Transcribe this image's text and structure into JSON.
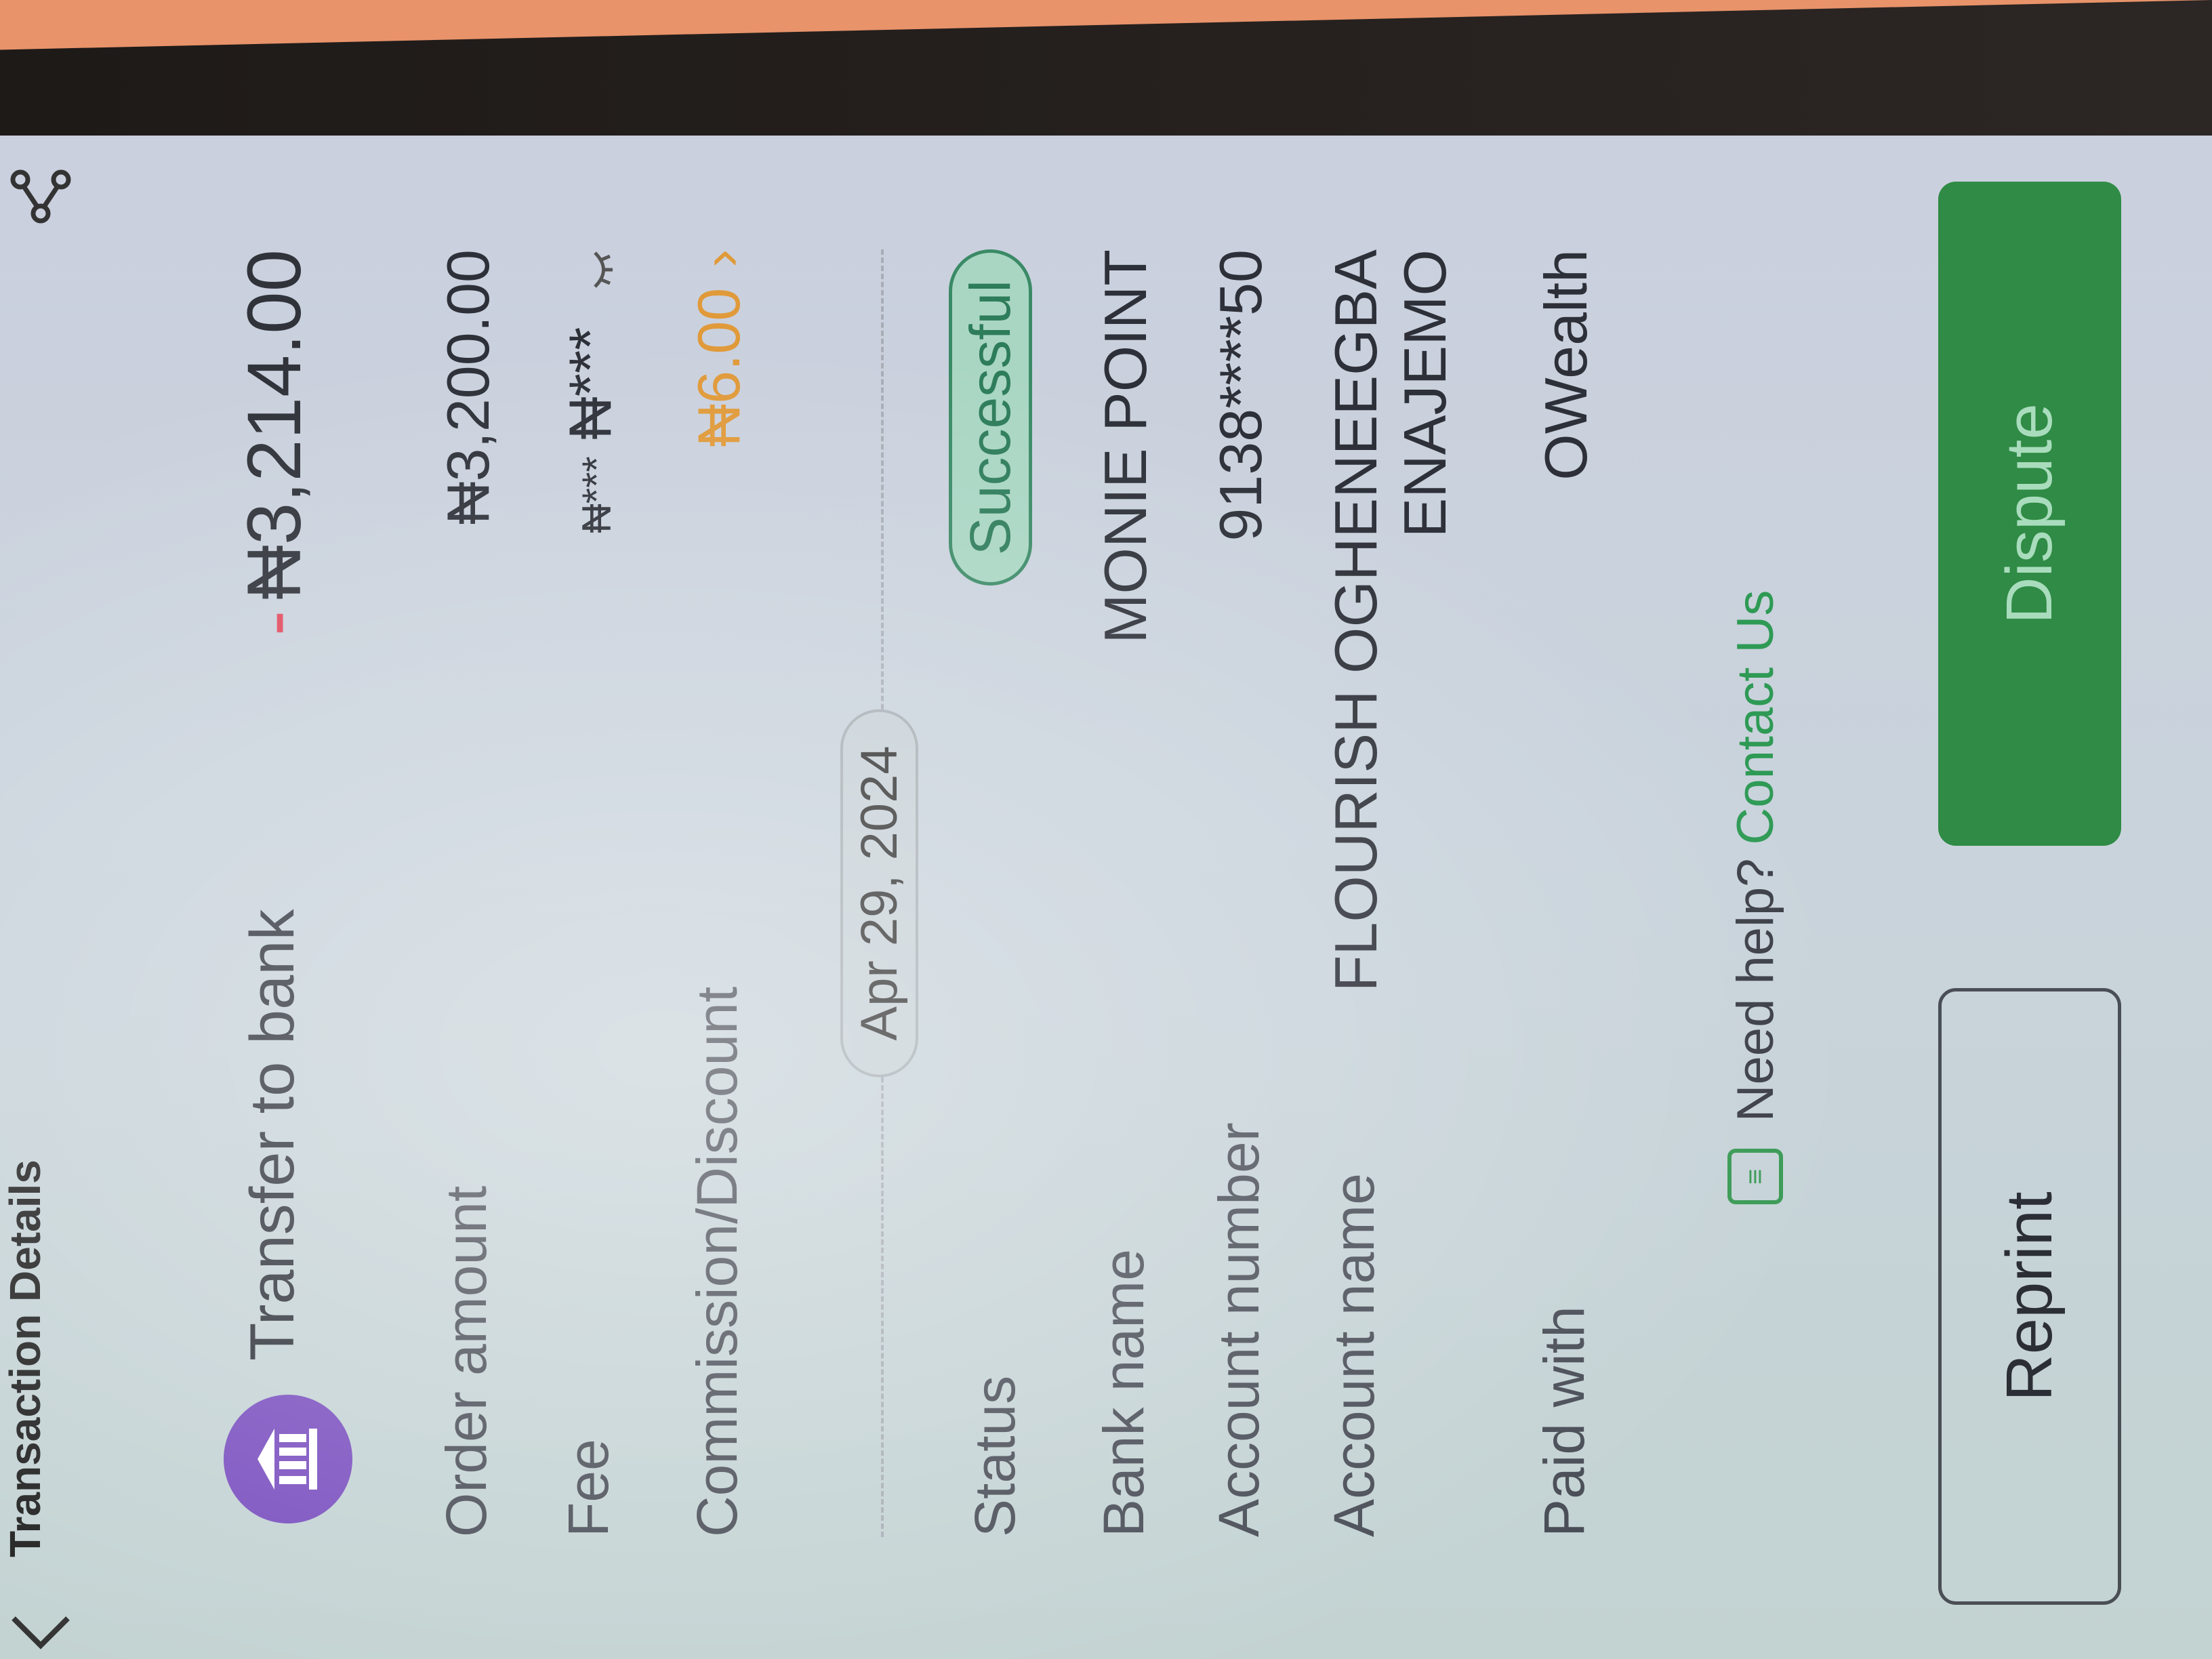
{
  "header": {
    "title": "Transaction Details"
  },
  "summary": {
    "icon": "bank-icon",
    "title": "Transfer to bank",
    "amount_sign": "-",
    "amount": "₦3,214.00"
  },
  "rows": {
    "order_amount": {
      "label": "Order amount",
      "value": "₦3,200.00"
    },
    "fee": {
      "label": "Fee",
      "value_masked_old": "₦***",
      "value_masked": "₦***"
    },
    "commission": {
      "label": "Commission/Discount",
      "value": "₦6.00"
    },
    "status": {
      "label": "Status",
      "value": "Successful"
    },
    "bank_name": {
      "label": "Bank name",
      "value": "MONIE POINT"
    },
    "account_number": {
      "label": "Account number",
      "value": "9138****50"
    },
    "account_name": {
      "label": "Account name",
      "value_line1": "FLOURISH OGHENEEGBA",
      "value_line2": "ENAJEMO"
    },
    "paid_with": {
      "label": "Paid with",
      "value": "OWealth"
    }
  },
  "date_separator": "Apr 29, 2024",
  "help": {
    "prompt": "Need help?",
    "link": "Contact Us"
  },
  "buttons": {
    "reprint": "Reprint",
    "dispute": "Dispute"
  },
  "colors": {
    "accent_green": "#2f8b45",
    "status_green": "#2d7c5a",
    "commission_orange": "#e09a3a",
    "bank_avatar_purple": "#7a4fbf",
    "debit_red": "#e24a5e"
  }
}
